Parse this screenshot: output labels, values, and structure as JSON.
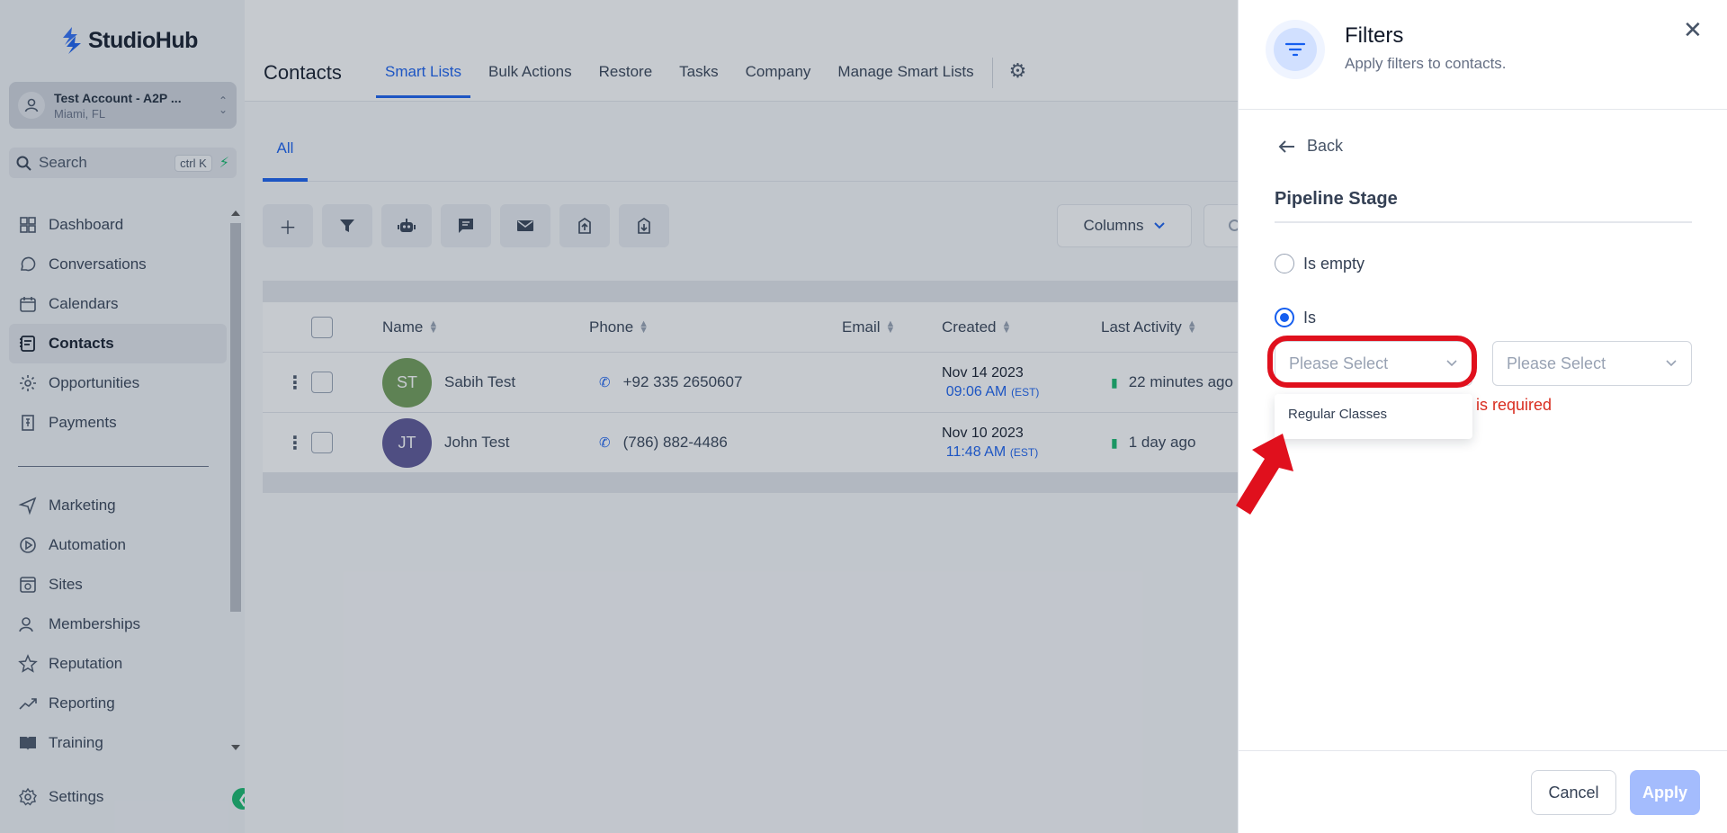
{
  "brand": {
    "name": "StudioHub"
  },
  "account": {
    "name": "Test Account - A2P ...",
    "location": "Miami, FL"
  },
  "search": {
    "label": "Search",
    "shortcut": "ctrl K"
  },
  "sidebar": {
    "items": [
      {
        "label": "Dashboard",
        "icon": "dashboard-icon"
      },
      {
        "label": "Conversations",
        "icon": "chat-bubble-icon"
      },
      {
        "label": "Calendars",
        "icon": "calendar-icon"
      },
      {
        "label": "Contacts",
        "icon": "contacts-icon",
        "active": true
      },
      {
        "label": "Opportunities",
        "icon": "opportunities-icon"
      },
      {
        "label": "Payments",
        "icon": "payments-icon"
      },
      {
        "label": "Marketing",
        "icon": "send-icon"
      },
      {
        "label": "Automation",
        "icon": "automation-icon"
      },
      {
        "label": "Sites",
        "icon": "sites-icon"
      },
      {
        "label": "Memberships",
        "icon": "memberships-icon"
      },
      {
        "label": "Reputation",
        "icon": "star-icon"
      },
      {
        "label": "Reporting",
        "icon": "trend-icon"
      },
      {
        "label": "Training",
        "icon": "book-icon"
      },
      {
        "label": "Settings",
        "icon": "gear-icon"
      }
    ]
  },
  "header": {
    "title": "Contacts",
    "tabs": [
      "Smart Lists",
      "Bulk Actions",
      "Restore",
      "Tasks",
      "Company",
      "Manage Smart Lists"
    ]
  },
  "subtabs": {
    "all": "All"
  },
  "toolbar": {
    "columns_label": "Columns"
  },
  "table": {
    "headers": {
      "name": "Name",
      "phone": "Phone",
      "email": "Email",
      "created": "Created",
      "last_activity": "Last Activity"
    },
    "rows": [
      {
        "initials": "ST",
        "name": "Sabih Test",
        "phone": "+92 335 2650607",
        "created_date": "Nov 14 2023",
        "created_time": "09:06 AM",
        "tz": "(EST)",
        "last_activity": "22 minutes ago",
        "avatar_color": "#6f9b55"
      },
      {
        "initials": "JT",
        "name": "John Test",
        "phone": "(786) 882-4486",
        "created_date": "Nov 10 2023",
        "created_time": "11:48 AM",
        "tz": "(EST)",
        "last_activity": "1 day ago",
        "avatar_color": "#5a5495"
      }
    ]
  },
  "filters": {
    "title": "Filters",
    "subtitle": "Apply filters to contacts.",
    "back_label": "Back",
    "section_title": "Pipeline Stage",
    "options": {
      "is_empty": "Is empty",
      "is": "Is"
    },
    "select_placeholder_1": "Please Select",
    "select_placeholder_2": "Please Select",
    "dropdown_option": "Regular Classes",
    "error": "is required",
    "cancel_label": "Cancel",
    "apply_label": "Apply"
  },
  "colors": {
    "accent": "#155eef",
    "highlight": "#e0101d",
    "success": "#12b76a"
  }
}
